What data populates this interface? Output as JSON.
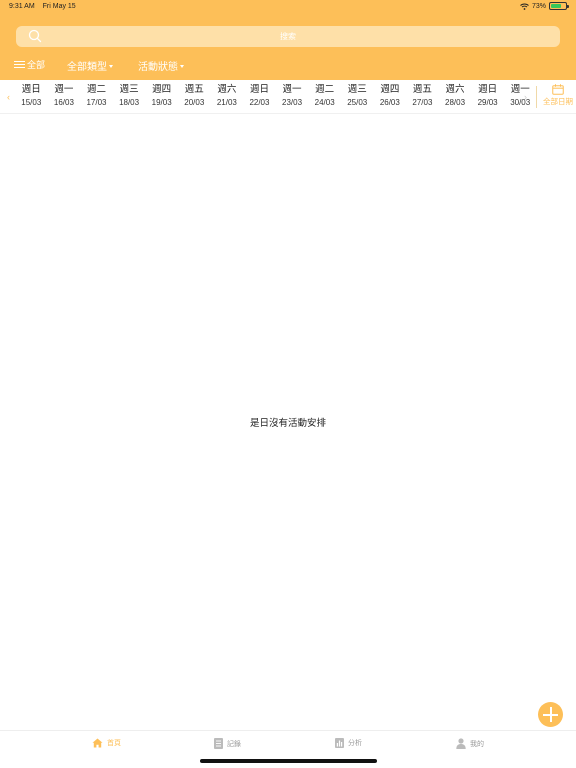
{
  "status_bar": {
    "time": "9:31 AM",
    "date": "Fri May 15",
    "battery_percent": "73%",
    "battery_level": 0.73
  },
  "search": {
    "placeholder": "搜索",
    "icon": "search-icon"
  },
  "filters": {
    "all": "全部",
    "type": "全部類型",
    "status": "活動狀態"
  },
  "date_strip": {
    "days": [
      {
        "day": "週日",
        "date": "15/03"
      },
      {
        "day": "週一",
        "date": "16/03"
      },
      {
        "day": "週二",
        "date": "17/03"
      },
      {
        "day": "週三",
        "date": "18/03"
      },
      {
        "day": "週四",
        "date": "19/03"
      },
      {
        "day": "週五",
        "date": "20/03"
      },
      {
        "day": "週六",
        "date": "21/03"
      },
      {
        "day": "週日",
        "date": "22/03"
      },
      {
        "day": "週一",
        "date": "23/03"
      },
      {
        "day": "週二",
        "date": "24/03"
      },
      {
        "day": "週三",
        "date": "25/03"
      },
      {
        "day": "週四",
        "date": "26/03"
      },
      {
        "day": "週五",
        "date": "27/03"
      },
      {
        "day": "週六",
        "date": "28/03"
      },
      {
        "day": "週日",
        "date": "29/03"
      },
      {
        "day": "週一",
        "date": "30/03"
      }
    ],
    "all_dates_label": "全部日期"
  },
  "empty_message": "是日沒有活動安排",
  "tabs": [
    {
      "label": "首頁",
      "icon": "home-icon",
      "active": true
    },
    {
      "label": "記錄",
      "icon": "document-icon",
      "active": false
    },
    {
      "label": "分析",
      "icon": "chart-icon",
      "active": false
    },
    {
      "label": "我的",
      "icon": "person-icon",
      "active": false
    }
  ],
  "colors": {
    "accent": "#fdbf58",
    "search_bg": "#fee0a8",
    "inactive": "#999999"
  }
}
